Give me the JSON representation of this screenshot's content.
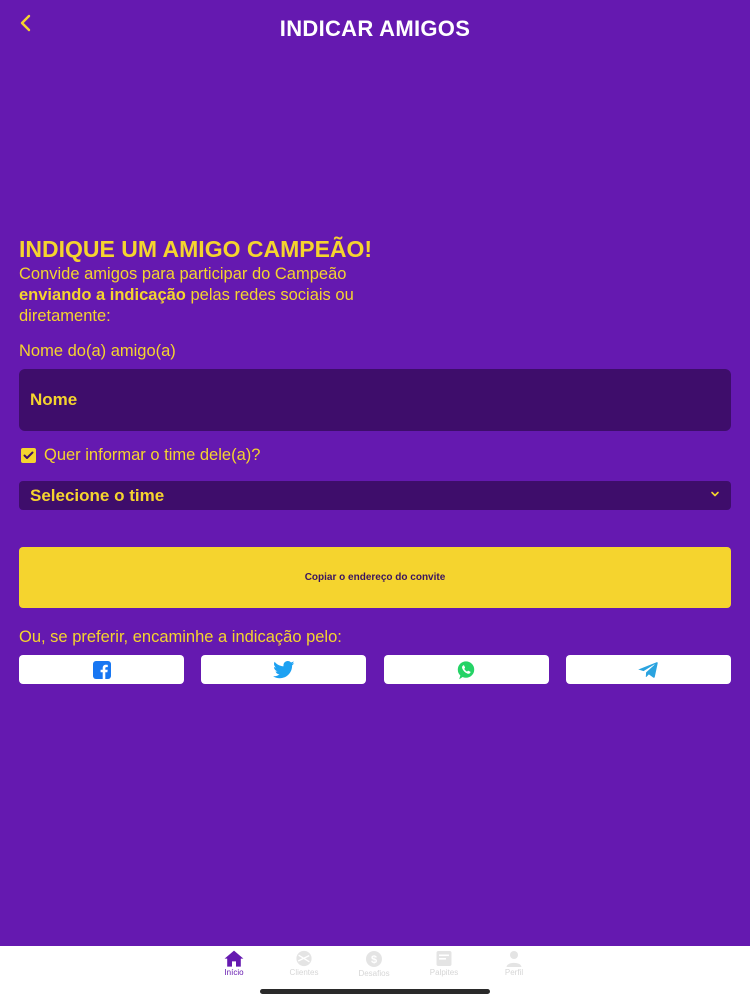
{
  "header": {
    "title": "INDICAR AMIGOS",
    "back_icon": "chevron-left-icon"
  },
  "referral": {
    "headline": "INDIQUE UM AMIGO CAMPEÃO!",
    "intro_start": "Convide amigos para participar do Campeão",
    "intro_bold": "enviando a indicação",
    "intro_end": "pelas redes sociais ou diretamente:"
  },
  "form": {
    "name_label": "Nome do(a) amigo(a)",
    "name_placeholder": "Nome",
    "name_value": "",
    "team_checkbox_label": "Quer informar o time dele(a)?",
    "team_checkbox_checked": true,
    "team_select_label": "Selecione o time"
  },
  "actions": {
    "copy_invite_label": "Copiar o endereço do convite",
    "share_label": "Ou, se preferir, encaminhe a indicação pelo:",
    "share_options": [
      "facebook",
      "twitter",
      "whatsapp",
      "telegram"
    ]
  },
  "tabbar": {
    "items": [
      {
        "label": "Início",
        "icon": "home-icon",
        "active": true
      },
      {
        "label": "Clientes",
        "icon": "ball-icon",
        "active": false
      },
      {
        "label": "Desafios",
        "icon": "coin-icon",
        "active": false
      },
      {
        "label": "Palpites",
        "icon": "ticket-icon",
        "active": false
      },
      {
        "label": "Perfil",
        "icon": "user-icon",
        "active": false
      }
    ]
  },
  "colors": {
    "background": "#6519b0",
    "accent": "#f5d42e",
    "input_background": "#3e0d6b",
    "facebook": "#1877f2",
    "twitter": "#1da1f2",
    "whatsapp": "#25d366",
    "telegram": "#2aa3df"
  }
}
